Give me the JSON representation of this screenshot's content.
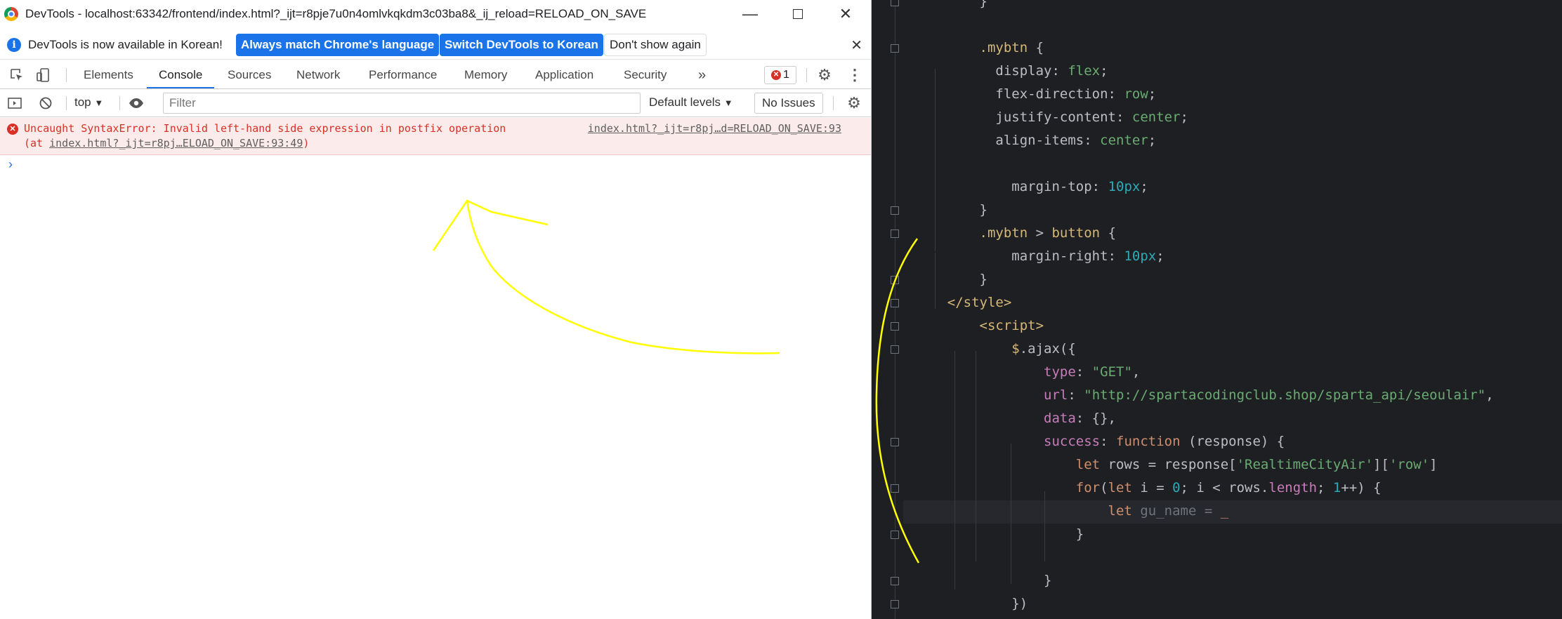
{
  "window": {
    "title": "DevTools - localhost:63342/frontend/index.html?_ijt=r8pje7u0n4omlvkqkdm3c03ba8&_ij_reload=RELOAD_ON_SAVE",
    "minimize_icon": "minimize-icon",
    "maximize_icon": "maximize-icon",
    "close_icon": "close-icon"
  },
  "infobar": {
    "message": "DevTools is now available in Korean!",
    "always_match": "Always match Chrome's language",
    "switch_korean": "Switch DevTools to Korean",
    "dont_show": "Don't show again"
  },
  "tabs": [
    "Elements",
    "Console",
    "Sources",
    "Network",
    "Performance",
    "Memory",
    "Application",
    "Security"
  ],
  "tabs_more": "»",
  "error_count": "1",
  "console_toolbar": {
    "context": "top",
    "filter_placeholder": "Filter",
    "levels": "Default levels",
    "issues": "No Issues"
  },
  "console_error": {
    "message": "Uncaught SyntaxError: Invalid left-hand side expression in postfix operation",
    "location": "index.html?_ijt=r8pj…d=RELOAD_ON_SAVE:93",
    "at_prefix": "(at ",
    "at_link": "index.html?_ijt=r8pj…ELOAD_ON_SAVE:93:49",
    "at_suffix": ")"
  },
  "console_prompt": "›",
  "editor": {
    "lines": [
      {
        "indent": "        ",
        "parts": [
          [
            "p",
            "}"
          ]
        ]
      },
      {
        "indent": "",
        "parts": []
      },
      {
        "indent": "        ",
        "parts": [
          [
            "s",
            ".mybtn"
          ],
          [
            "p",
            " {"
          ]
        ]
      },
      {
        "indent": "          ",
        "parts": [
          [
            "p",
            "display"
          ],
          [
            "p",
            ": "
          ],
          [
            "v",
            "flex"
          ],
          [
            "p",
            ";"
          ]
        ]
      },
      {
        "indent": "          ",
        "parts": [
          [
            "p",
            "flex-direction"
          ],
          [
            "p",
            ": "
          ],
          [
            "v",
            "row"
          ],
          [
            "p",
            ";"
          ]
        ]
      },
      {
        "indent": "          ",
        "parts": [
          [
            "p",
            "justify-content"
          ],
          [
            "p",
            ": "
          ],
          [
            "v",
            "center"
          ],
          [
            "p",
            ";"
          ]
        ]
      },
      {
        "indent": "          ",
        "parts": [
          [
            "p",
            "align-items"
          ],
          [
            "p",
            ": "
          ],
          [
            "v",
            "center"
          ],
          [
            "p",
            ";"
          ]
        ]
      },
      {
        "indent": "",
        "parts": []
      },
      {
        "indent": "            ",
        "parts": [
          [
            "p",
            "margin-top"
          ],
          [
            "p",
            ": "
          ],
          [
            "n",
            "10px"
          ],
          [
            "p",
            ";"
          ]
        ]
      },
      {
        "indent": "        ",
        "parts": [
          [
            "p",
            "}"
          ]
        ]
      },
      {
        "indent": "        ",
        "parts": [
          [
            "s",
            ".mybtn"
          ],
          [
            "p",
            " > "
          ],
          [
            "s",
            "button"
          ],
          [
            "p",
            " {"
          ]
        ]
      },
      {
        "indent": "            ",
        "parts": [
          [
            "p",
            "margin-right"
          ],
          [
            "p",
            ": "
          ],
          [
            "n",
            "10px"
          ],
          [
            "p",
            ";"
          ]
        ]
      },
      {
        "indent": "        ",
        "parts": [
          [
            "p",
            "}"
          ]
        ]
      },
      {
        "indent": "    ",
        "parts": [
          [
            "t",
            "</style>"
          ]
        ]
      },
      {
        "indent": "        ",
        "parts": [
          [
            "t",
            "<script>"
          ]
        ]
      },
      {
        "indent": "            ",
        "parts": [
          [
            "t",
            "$"
          ],
          [
            "p",
            ".ajax({"
          ]
        ]
      },
      {
        "indent": "                ",
        "parts": [
          [
            "k",
            "type"
          ],
          [
            "p",
            ": "
          ],
          [
            "g",
            "\"GET\""
          ],
          [
            "p",
            ","
          ]
        ]
      },
      {
        "indent": "                ",
        "parts": [
          [
            "k",
            "url"
          ],
          [
            "p",
            ": "
          ],
          [
            "g",
            "\"http://spartacodingclub.shop/sparta_api/seoulair\""
          ],
          [
            "p",
            ","
          ]
        ]
      },
      {
        "indent": "                ",
        "parts": [
          [
            "k",
            "data"
          ],
          [
            "p",
            ": {},"
          ]
        ]
      },
      {
        "indent": "                ",
        "parts": [
          [
            "k",
            "success"
          ],
          [
            "p",
            ": "
          ],
          [
            "w",
            "function"
          ],
          [
            "p",
            " (response) {"
          ]
        ]
      },
      {
        "indent": "                    ",
        "parts": [
          [
            "w",
            "let"
          ],
          [
            "p",
            " rows = response["
          ],
          [
            "g",
            "'RealtimeCityAir'"
          ],
          [
            "p",
            "]["
          ],
          [
            "g",
            "'row'"
          ],
          [
            "p",
            "]"
          ]
        ]
      },
      {
        "indent": "                    ",
        "parts": [
          [
            "w",
            "for"
          ],
          [
            "p",
            "("
          ],
          [
            "w",
            "let"
          ],
          [
            "p",
            " i = "
          ],
          [
            "n",
            "0"
          ],
          [
            "p",
            "; i < rows."
          ],
          [
            "f",
            "length"
          ],
          [
            "p",
            "; "
          ],
          [
            "n",
            "1"
          ],
          [
            "p",
            "++) {"
          ]
        ]
      },
      {
        "indent": "                        ",
        "parts": [
          [
            "w",
            "let"
          ],
          [
            "d",
            " gu_name ="
          ],
          [
            "w",
            " _"
          ]
        ]
      },
      {
        "indent": "                    ",
        "parts": [
          [
            "p",
            "}"
          ]
        ]
      },
      {
        "indent": "",
        "parts": []
      },
      {
        "indent": "                ",
        "parts": [
          [
            "p",
            "}"
          ]
        ]
      },
      {
        "indent": "            ",
        "parts": [
          [
            "p",
            "})"
          ]
        ]
      }
    ]
  },
  "annotation_color": "#ffff00"
}
